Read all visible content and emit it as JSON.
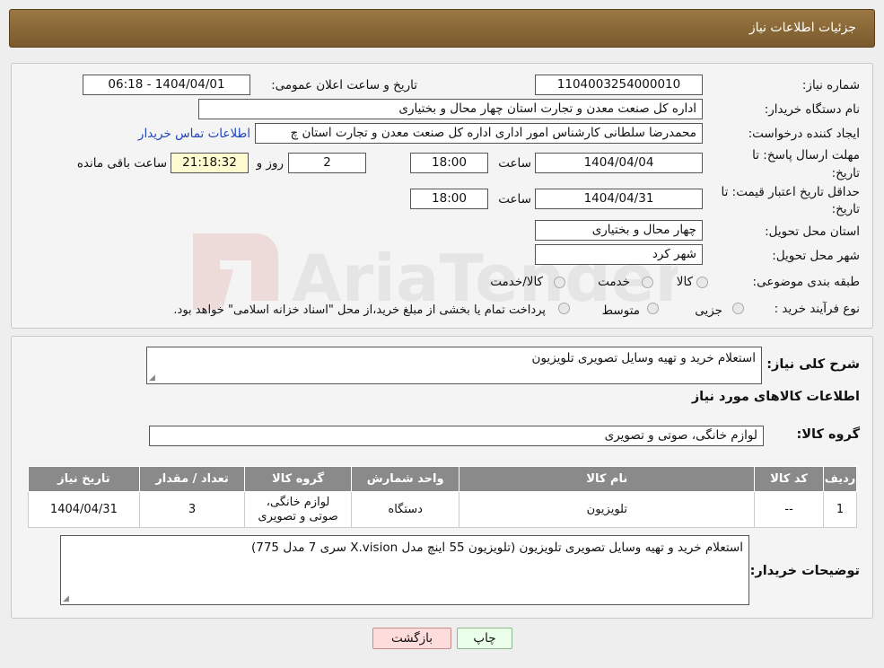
{
  "header": {
    "title": "جزئیات اطلاعات نیاز"
  },
  "watermark": {
    "text": "AriaTender.net"
  },
  "form": {
    "need_number_label": "شماره نیاز:",
    "need_number": "1104003254000010",
    "announce_label": "تاریخ و ساعت اعلان عمومی:",
    "announce_value": "1404/04/01 - 06:18",
    "buyer_org_label": "نام دستگاه خریدار:",
    "buyer_org": "اداره کل صنعت  معدن و تجارت استان چهار محال و بختیاری",
    "creator_label": "ایجاد کننده درخواست:",
    "creator": "محمدرضا سلطانی کارشناس امور اداری اداره کل صنعت  معدن و تجارت استان چ",
    "contact_link": "اطلاعات تماس خریدار",
    "deadline_label_1": "مهلت ارسال پاسخ: تا",
    "deadline_label_2": "تاریخ:",
    "deadline_date": "1404/04/04",
    "time_label": "ساعت",
    "deadline_time": "18:00",
    "days_value": "2",
    "days_label": "روز و",
    "remaining_time": "21:18:32",
    "remaining_label": "ساعت باقی مانده",
    "validity_label_1": "حداقل تاریخ اعتبار قیمت: تا",
    "validity_label_2": "تاریخ:",
    "validity_date": "1404/04/31",
    "validity_time_label": "ساعت",
    "validity_time": "18:00",
    "province_label": "استان محل تحویل:",
    "province": "چهار محال و بختیاری",
    "city_label": "شهر محل تحویل:",
    "city": "شهر کرد",
    "category_label": "طبقه بندی موضوعی:",
    "category_options": [
      "کالا",
      "خدمت",
      "کالا/خدمت"
    ],
    "process_label": "نوع فرآیند خرید :",
    "process_options": [
      "جزیی",
      "متوسط"
    ],
    "process_note": "پرداخت تمام یا بخشی از مبلغ خرید،از محل \"اسناد خزانه اسلامی\" خواهد بود."
  },
  "details": {
    "summary_label": "شرح کلی نیاز:",
    "summary": "استعلام خرید  و تهیه وسایل تصویری  تلویزیون",
    "goods_info_title": "اطلاعات کالاهای مورد نیاز",
    "goods_group_label": "گروه کالا:",
    "goods_group": "لوازم خانگی، صوتی و تصویری",
    "table": {
      "headers": [
        "ردیف",
        "کد کالا",
        "نام کالا",
        "واحد شمارش",
        "گروه کالا",
        "تعداد / مقدار",
        "تاریخ نیاز"
      ],
      "rows": [
        {
          "row": "1",
          "code": "--",
          "name": "تلویزیون",
          "unit": "دستگاه",
          "group_line1": "لوازم خانگی،",
          "group_line2": "صوتی و تصویری",
          "qty": "3",
          "date": "1404/04/31"
        }
      ]
    },
    "buyer_notes_label": "توضیحات خریدار:",
    "buyer_notes": "استعلام خرید و تهیه وسایل تصویری  تلویزیون       (تلویزیون 55 اینچ  مدل X.vision سری 7 مدل 775)"
  },
  "buttons": {
    "print": "چاپ",
    "back": "بازگشت"
  }
}
